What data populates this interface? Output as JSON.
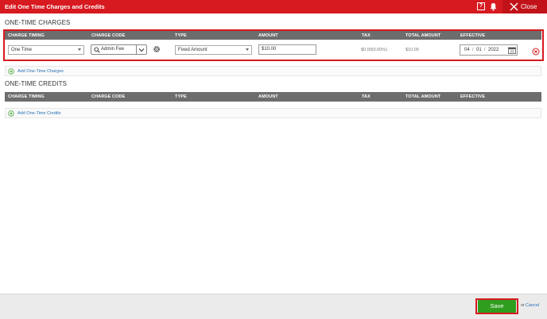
{
  "header": {
    "title": "Edit One Time Charges and Credits",
    "help_label": "?",
    "close_label": "Close",
    "accent_color": "#d71920"
  },
  "charges": {
    "section_title": "ONE-TIME CHARGES",
    "columns": [
      "CHARGE TIMING",
      "CHARGE CODE",
      "TYPE",
      "AMOUNT",
      "TAX",
      "TOTAL AMOUNT",
      "EFFECTIVE"
    ],
    "row": {
      "charge_timing": "One Time",
      "charge_code": "Admin Fee",
      "type": "Fixed Amount",
      "amount": "$10.00",
      "tax": "$0.00(0.00%)",
      "total_amount": "$10.00",
      "effective_month": "04",
      "effective_day": "01",
      "effective_year": "2022"
    },
    "add_label": "Add One-Time Charges"
  },
  "credits": {
    "section_title": "ONE-TIME CREDITS",
    "columns": [
      "CHARGE TIMING",
      "CHARGE CODE",
      "TYPE",
      "AMOUNT",
      "TAX",
      "TOTAL AMOUNT",
      "EFFECTIVE"
    ],
    "add_label": "Add One-Time Credits"
  },
  "footer": {
    "save_label": "Save",
    "or_text": "or",
    "cancel_label": "Cancel",
    "save_color": "#2f9e1e"
  },
  "icons": [
    "question-icon",
    "bell-icon",
    "close-icon",
    "search-icon",
    "chevron-down-icon",
    "gear-icon",
    "calendar-icon",
    "remove-icon",
    "plus-circle-icon"
  ]
}
